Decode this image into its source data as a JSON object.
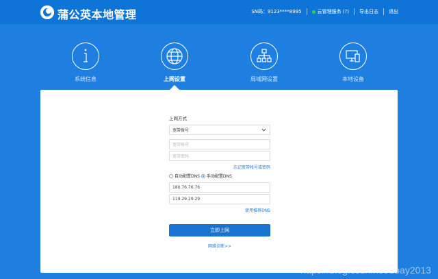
{
  "header": {
    "brand": "蒲公英本地管理",
    "sn": "SN码：9123****8995",
    "cloud_status": "云管理服务 (?)",
    "export_log": "导出日志",
    "logout": "退出",
    "status_color": "#35d23a"
  },
  "nav": [
    {
      "label": "系统信息",
      "icon": "info-icon"
    },
    {
      "label": "上网设置",
      "icon": "globe-icon",
      "active": true
    },
    {
      "label": "局域网设置",
      "icon": "network-icon"
    },
    {
      "label": "本地设备",
      "icon": "devices-icon"
    }
  ],
  "form": {
    "mode_label": "上网方式",
    "mode_value": "宽带拨号",
    "account_placeholder": "宽带帐号",
    "password_placeholder": "宽带密码",
    "forgot_link": "忘记宽带帐号或密码",
    "dns_auto": "自动配置DNS",
    "dns_manual": "手动配置DNS",
    "dns1": "180.76.76.76",
    "dns2": "119.29.29.29",
    "recommended_dns": "使用推荐DNS",
    "submit": "立即上网",
    "diagnose": "网络诊断>>"
  },
  "watermark": "https://blog.csdn.net/ubay2013",
  "colors": {
    "background": "#1e7fe0",
    "header": "#0f74d8",
    "accent": "#1873d3"
  }
}
